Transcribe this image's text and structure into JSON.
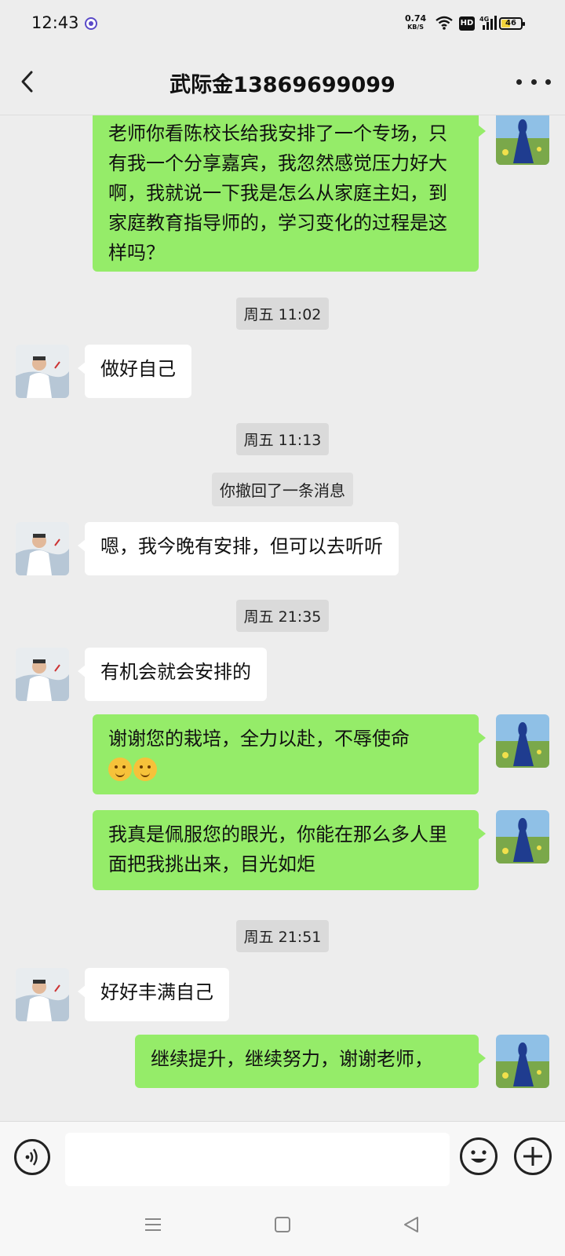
{
  "status": {
    "time": "12:43",
    "net_speed": "0.74",
    "net_unit": "KB/S",
    "hd": "HD",
    "signal_gen": "4G",
    "battery": "46",
    "battery_level": 0.46
  },
  "header": {
    "title": "武际金13869699099",
    "back_icon": "chevron-left-icon",
    "more_icon": "more-dots-icon"
  },
  "messages": [
    {
      "type": "me",
      "text": "老师你看陈校长给我安排了一个专场，只有我一个分享嘉宾，我忽然感觉压力好大啊，我就说一下我是怎么从家庭主妇，到家庭教育指导师的，学习变化的过程是这样吗？"
    },
    {
      "type": "time",
      "text": "周五 11:02"
    },
    {
      "type": "other",
      "text": "做好自己"
    },
    {
      "type": "time",
      "text": "周五 11:13"
    },
    {
      "type": "system",
      "text": "你撤回了一条消息"
    },
    {
      "type": "other",
      "text": "嗯，我今晚有安排，但可以去听听"
    },
    {
      "type": "time",
      "text": "周五 21:35"
    },
    {
      "type": "other",
      "text": "有机会就会安排的"
    },
    {
      "type": "me",
      "text": "谢谢您的栽培，全力以赴，不辱使命"
    },
    {
      "type": "me",
      "text": "我真是佩服您的眼光，你能在那么多人里面把我挑出来，目光如炬"
    },
    {
      "type": "time",
      "text": "周五 21:51"
    },
    {
      "type": "other",
      "text": "好好丰满自己"
    },
    {
      "type": "me",
      "text": "继续提升，继续努力，谢谢老师，"
    }
  ],
  "input": {
    "placeholder": "",
    "voice_icon": "voice-icon",
    "emoji_icon": "emoji-icon",
    "plus_icon": "plus-icon"
  },
  "colors": {
    "me_bubble": "#95ec69",
    "other_bubble": "#ffffff",
    "background": "#ededed"
  }
}
